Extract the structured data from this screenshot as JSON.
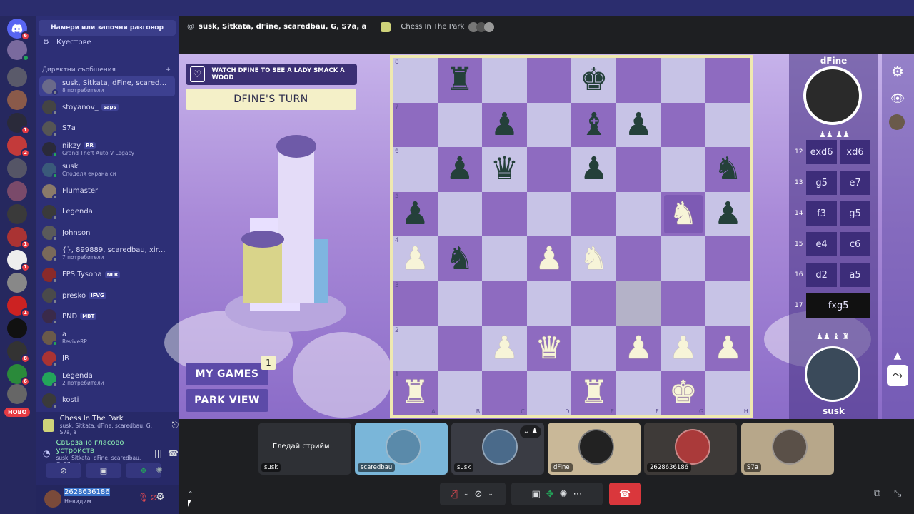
{
  "sidebar": {
    "search_placeholder": "Намери или започни разговор",
    "quests_label": "Куестове",
    "dm_header": "Директни съобщения",
    "dm_add": "+",
    "dms": [
      {
        "name": "susk, Sitkata, dFine, scaredbau,...",
        "sub": "8 потребители",
        "tag": ""
      },
      {
        "name": "stoyanov_",
        "sub": "",
        "tag": "saps"
      },
      {
        "name": "S7a",
        "sub": "",
        "tag": ""
      },
      {
        "name": "nikzy",
        "sub": "Grand Theft Auto V Legacy",
        "tag": "RR"
      },
      {
        "name": "susk",
        "sub": "Споделя екрана си",
        "tag": ""
      },
      {
        "name": "Flumaster",
        "sub": "",
        "tag": ""
      },
      {
        "name": "Legenda",
        "sub": "",
        "tag": ""
      },
      {
        "name": "Johnson",
        "sub": "",
        "tag": ""
      },
      {
        "name": "{}, 899889, scaredbau, xire, fain...",
        "sub": "7 потребители",
        "tag": ""
      },
      {
        "name": "FPS Tysona",
        "sub": "",
        "tag": "NLR"
      },
      {
        "name": "presko",
        "sub": "",
        "tag": "IFVG"
      },
      {
        "name": "PND",
        "sub": "",
        "tag": "MBT"
      },
      {
        "name": "a",
        "sub": "ReviveRP",
        "tag": ""
      },
      {
        "name": "JR",
        "sub": "",
        "tag": ""
      },
      {
        "name": "Legenda",
        "sub": "2 потребители",
        "tag": ""
      },
      {
        "name": "kosti",
        "sub": "",
        "tag": ""
      }
    ],
    "novo_badge": "НОВО",
    "voice": {
      "activity_title": "Chess In The Park",
      "activity_sub": "susk, Sitkata, dFine, scaredbau, G, S7a, a",
      "connected_title": "Свързано гласово устройств",
      "connected_sub": "susk, Sitkata, dFine, scaredbau, G, S7a, a"
    },
    "user": {
      "name": "2628636186",
      "status": "Невидим"
    }
  },
  "header": {
    "channel": "susk, Sitkata, dFine, scaredbau, G, S7a, a",
    "activity": "Chess In The Park"
  },
  "game": {
    "watch_banner": "WATCH DFINE TO SEE A LADY SMACK A WOOD",
    "turn_label": "DFINE'S TURN",
    "my_games": "MY GAMES",
    "my_games_count": "1",
    "park_view": "PARK VIEW",
    "top_player": "dFine",
    "bottom_player": "susk",
    "moves": [
      {
        "num": "12",
        "white": "exd6",
        "black": "xd6",
        "current": false
      },
      {
        "num": "13",
        "white": "g5",
        "black": "e7",
        "current": false
      },
      {
        "num": "14",
        "white": "f3",
        "black": "g5",
        "current": false
      },
      {
        "num": "15",
        "white": "e4",
        "black": "c6",
        "current": false
      },
      {
        "num": "16",
        "white": "d2",
        "black": "a5",
        "current": false
      },
      {
        "num": "17",
        "white": "fxg5",
        "black": "",
        "current": true
      }
    ],
    "board_ranks": [
      "8",
      "7",
      "6",
      "5",
      "4",
      "3",
      "2",
      "1"
    ],
    "board_files": [
      "A",
      "B",
      "C",
      "D",
      "E",
      "F",
      "G",
      "H"
    ],
    "board": [
      [
        "",
        "b:♜",
        "",
        "",
        "b:♚",
        "",
        "",
        ""
      ],
      [
        "",
        "",
        "b:♟",
        "",
        "b:♝",
        "b:♟",
        "",
        ""
      ],
      [
        "",
        "b:♟",
        "b:♛",
        "",
        "b:♟",
        "",
        "",
        "b:♞"
      ],
      [
        "b:♟",
        "",
        "",
        "",
        "",
        "",
        "w:♞",
        "b:♟"
      ],
      [
        "w:♟",
        "b:♞",
        "",
        "w:♟",
        "w:♞",
        "",
        "",
        ""
      ],
      [
        "",
        "",
        "",
        "",
        "",
        "",
        "",
        ""
      ],
      [
        "",
        "",
        "w:♟",
        "w:♛",
        "",
        "w:♟",
        "w:♟",
        "w:♟"
      ],
      [
        "w:♜",
        "",
        "",
        "",
        "w:♜",
        "",
        "w:♚",
        ""
      ]
    ]
  },
  "thumbs": [
    {
      "label": "susk",
      "overlay": "Гледай стрийм"
    },
    {
      "label": "scaredbau",
      "overlay": ""
    },
    {
      "label": "susk",
      "overlay": ""
    },
    {
      "label": "dFine",
      "overlay": ""
    },
    {
      "label": "2628636186",
      "overlay": ""
    },
    {
      "label": "S7a",
      "overlay": ""
    }
  ],
  "colors": {
    "accent": "#5865f2",
    "hangup": "#da373c",
    "board_dark": "#8e6bc0",
    "board_light": "#c7c3e6"
  }
}
